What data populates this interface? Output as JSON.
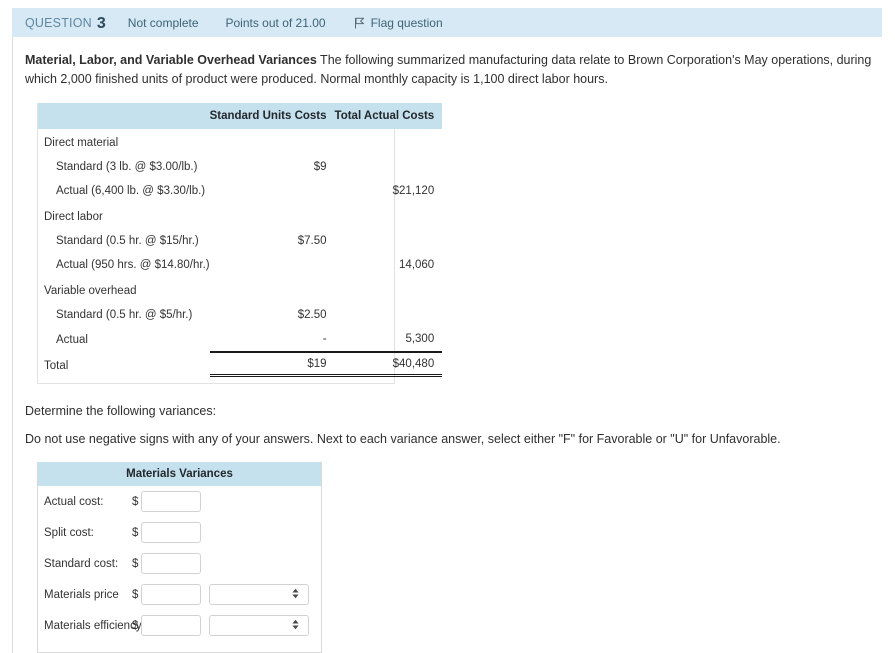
{
  "header": {
    "question_label": "QUESTION",
    "question_number": "3",
    "state": "Not complete",
    "points": "Points out of 21.00",
    "flag_label": "Flag question",
    "flag_icon": "flag-icon",
    "background_color": "#d6e9f5"
  },
  "intro": {
    "title": "Material, Labor, and Variable Overhead Variances",
    "text": " The following summarized manufacturing data relate to Brown Corporation's May operations, during which 2,000 finished units of product were produced. Normal monthly capacity is 1,100 direct labor hours."
  },
  "data_table": {
    "header_background": "#c4e1ed",
    "columns": [
      "",
      "Standard Units Costs",
      "Total Actual Costs"
    ],
    "rows": [
      {
        "label": "Direct material",
        "type": "group",
        "standard": "",
        "actual": ""
      },
      {
        "label": "Standard (3 lb. @ $3.00/lb.)",
        "type": "item",
        "standard": "$9",
        "actual": ""
      },
      {
        "label": "Actual (6,400 lb. @ $3.30/lb.)",
        "type": "item",
        "standard": "",
        "actual": "$21,120"
      },
      {
        "label": "Direct labor",
        "type": "group",
        "standard": "",
        "actual": ""
      },
      {
        "label": "Standard (0.5 hr. @ $15/hr.)",
        "type": "item",
        "standard": "$7.50",
        "actual": ""
      },
      {
        "label": "Actual (950 hrs. @ $14.80/hr.)",
        "type": "item",
        "standard": "",
        "actual": "14,060"
      },
      {
        "label": "Variable overhead",
        "type": "group",
        "standard": "",
        "actual": ""
      },
      {
        "label": "Standard (0.5 hr. @ $5/hr.)",
        "type": "item",
        "standard": "$2.50",
        "actual": ""
      },
      {
        "label": "Actual",
        "type": "item-last",
        "standard": "-",
        "actual": "5,300"
      }
    ],
    "total": {
      "label": "Total",
      "standard": "$19",
      "actual": "$40,480"
    }
  },
  "prompts": {
    "determine": "Determine the following variances:",
    "no_negative": "Do not use negative signs with any of your answers. Next to each variance answer, select either \"F\" for Favorable or \"U\" for Unfavorable."
  },
  "answer_form": {
    "title": "Materials Variances",
    "title_background": "#c4e1ed",
    "dollar_sign": "$",
    "rows": [
      {
        "label": "Actual cost:",
        "value": "",
        "has_select": false,
        "select_value": ""
      },
      {
        "label": "Split cost:",
        "value": "",
        "has_select": false,
        "select_value": ""
      },
      {
        "label": "Standard cost:",
        "value": "",
        "has_select": false,
        "select_value": ""
      },
      {
        "label": "Materials price",
        "value": "",
        "has_select": true,
        "select_value": ""
      },
      {
        "label": "Materials efficiency",
        "value": "",
        "has_select": true,
        "select_value": ""
      }
    ]
  }
}
